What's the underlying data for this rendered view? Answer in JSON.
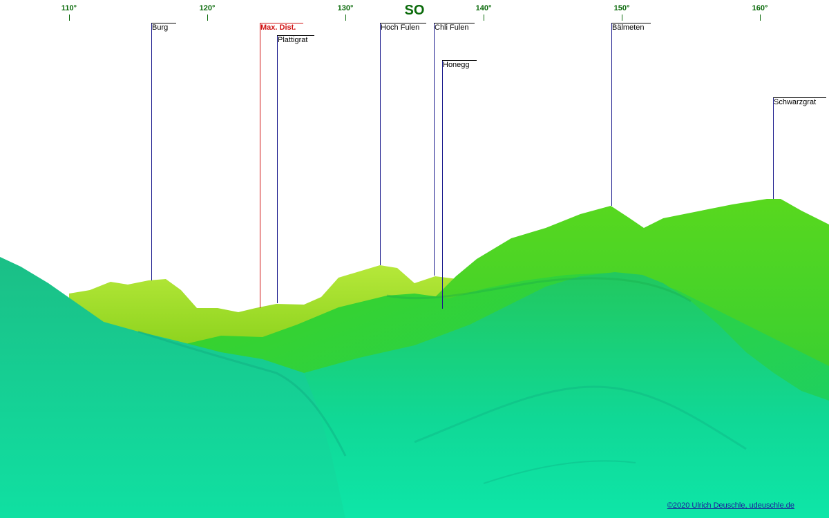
{
  "compass": {
    "label": "SO"
  },
  "degree_ticks": [
    {
      "label": "110°"
    },
    {
      "label": "120°"
    },
    {
      "label": "130°"
    },
    {
      "label": "140°"
    },
    {
      "label": "150°"
    },
    {
      "label": "160°"
    }
  ],
  "peaks": [
    {
      "name": "Burg"
    },
    {
      "name": "Max. Dist."
    },
    {
      "name": "Plattigrat"
    },
    {
      "name": "Hoch Fulen"
    },
    {
      "name": "Chli Fulen"
    },
    {
      "name": "Honegg"
    },
    {
      "name": "Bälmeten"
    },
    {
      "name": "Schwarzgrat"
    }
  ],
  "colors": {
    "tick": "#0a6a0a",
    "peak_line": "#1a1a8c",
    "max_dist": "#d01010",
    "far_ridge": "#a8e02a",
    "mid_ridge": "#4cd21a",
    "near_slope": "#16e09a"
  },
  "credit": {
    "text": "©2020 Ulrich Deuschle, udeuschle.de"
  }
}
